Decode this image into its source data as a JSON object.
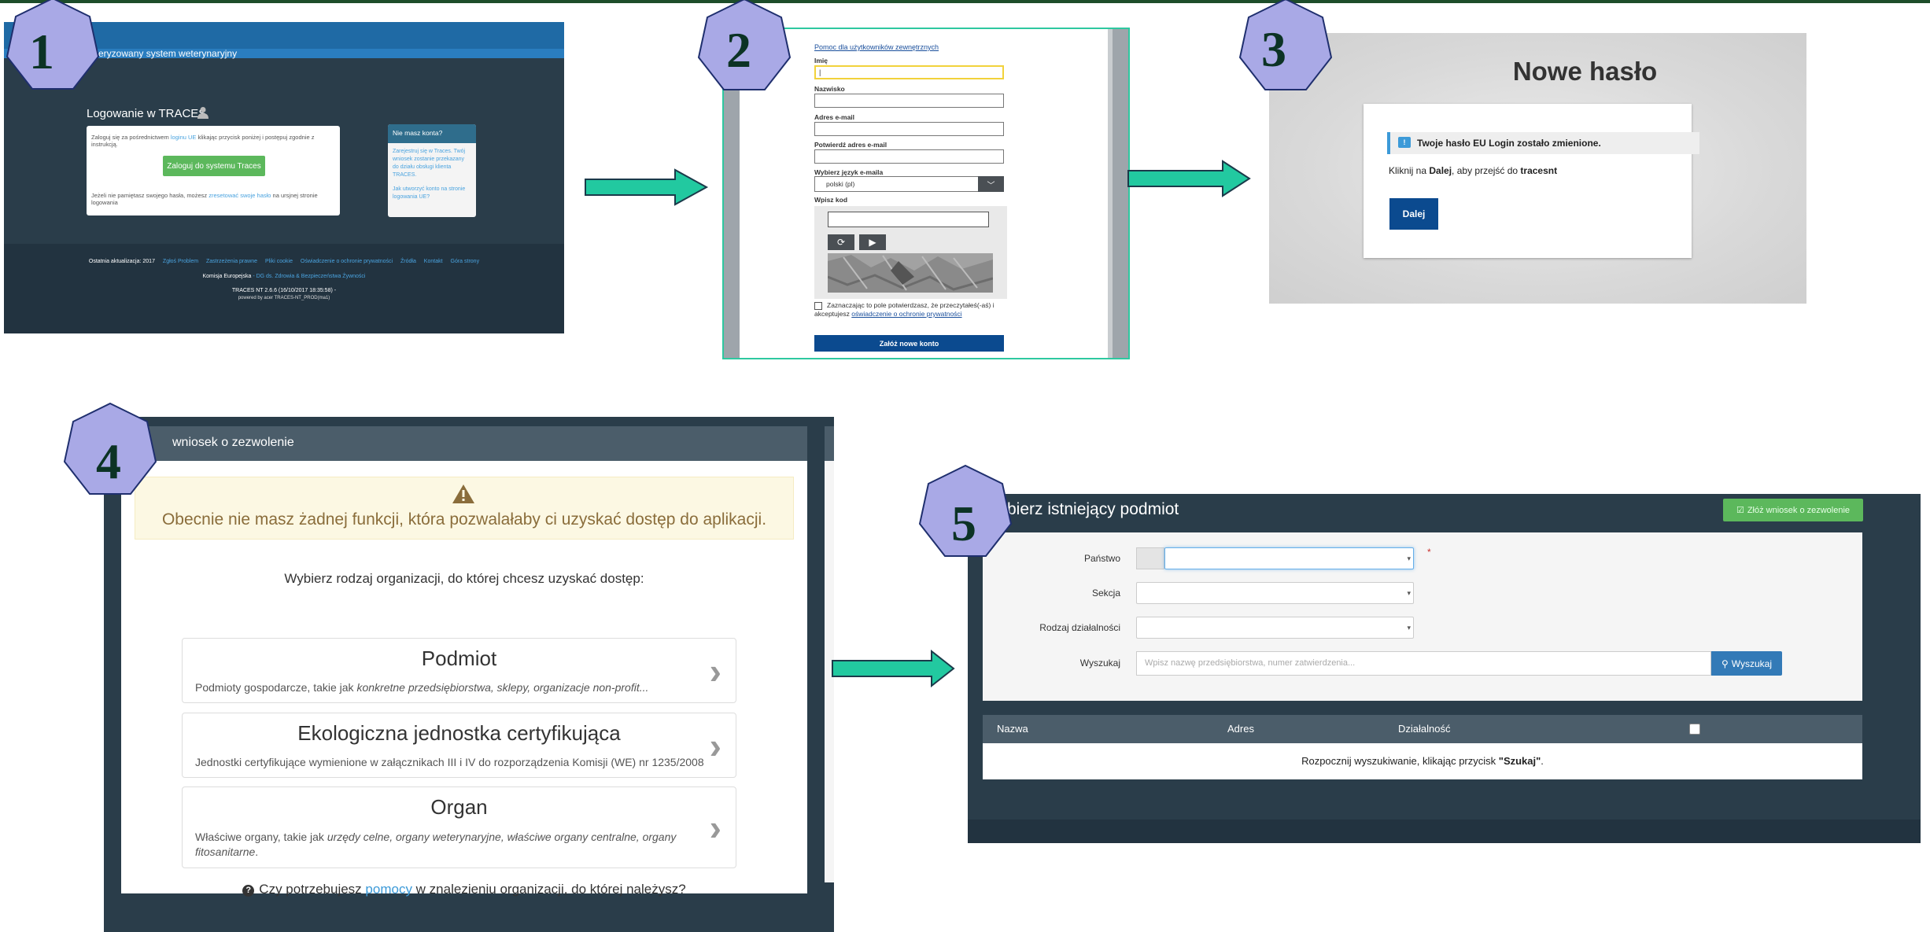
{
  "badges": [
    "1",
    "2",
    "3",
    "4",
    "5"
  ],
  "colors": {
    "badge_fill": "#a9a9e6",
    "badge_stroke": "#1f2f6e",
    "arrow_fill": "#22c9a0",
    "badge_text": "#0c3325"
  },
  "panel1": {
    "app_title": "uteryzowany system weterynaryjny",
    "login_title": "Logowanie w TRACES",
    "instr_pre": "Zaloguj się za pośrednictwem ",
    "instr_link": "loginu UE",
    "instr_post": " klikając przycisk poniżej i postępuj zgodnie z instrukcją.",
    "login_button": "Zaloguj do systemu Traces",
    "forgot_pre": "Jeżeli nie pamiętasz swojego hasła, możesz ",
    "forgot_link": "zresetować swoje hasło",
    "forgot_post": " na ursjnej stronie logowania",
    "side_title": "Nie masz konta?",
    "side_text1": "Zarejestruj się w Traces. Twój wniosek zostanie przekazany do działu obsługi klienta TRACES.",
    "side_text2": "Jak utworzyć konto na stronie logowania UE?",
    "footer_links": [
      "Ostatnia aktualizacja: 2017",
      "Zgłoś Problem",
      "Zastrzeżenia prawne",
      "Pliki cookie",
      "Oświadczenie o ochronie prywatności",
      "Źródła",
      "Kontakt",
      "Góra strony"
    ],
    "footer_line2_a": "Komisja Europejska",
    "footer_line2_b": " - DG ds. Zdrowia & Bezpieczeństwa Żywności",
    "footer_line3": "TRACES NT 2.6.6 (16/10/2017 18:35:58) -",
    "footer_line4": "powered by acer TRACES-NT_PROD(ma1)"
  },
  "panel2": {
    "help_link": "Pomoc dla użytkowników zewnętrznych",
    "first_name_label": "Imię",
    "first_name_value": "|",
    "last_name_label": "Nazwisko",
    "email_label": "Adres e-mail",
    "email_confirm_label": "Potwierdź adres e-mail",
    "lang_label": "Wybierz język e-maila",
    "lang_value": "polski (pl)",
    "captcha_label": "Wpisz kod",
    "consent_text": "Zaznaczając to pole potwierdzasz, że przeczytałeś(-aś) i akceptujesz ",
    "consent_link": "oświadczenie o ochronie prywatności",
    "create_button": "Załóż nowe konto"
  },
  "panel3": {
    "title": "Nowe hasło",
    "alert_text": "Twoje hasło EU Login zostało zmienione.",
    "line_pre": "Kliknij na ",
    "line_bold1": "Dalej",
    "line_mid": ", aby przejść do ",
    "line_bold2": "tracesnt",
    "next_button": "Dalej"
  },
  "panel4": {
    "header": "wniosek o zezwolenie",
    "warning": "Obecnie nie masz żadnej funkcji, która pozwalałaby ci uzyskać dostęp do aplikacji.",
    "choose": "Wybierz rodzaj organizacji, do której chcesz uzyskać dostęp:",
    "options": [
      {
        "title": "Podmiot",
        "desc_pre": "Podmioty gospodarcze, takie jak ",
        "desc_em": "konkretne przedsiębiorstwa, sklepy, organizacje non-profit...",
        "desc_post": ""
      },
      {
        "title": "Ekologiczna jednostka certyfikująca",
        "desc_pre": "Jednostki certyfikujące wymienione w załącznikach III i IV do rozporządzenia Komisji (WE) nr 1235/2008",
        "desc_em": "",
        "desc_post": ""
      },
      {
        "title": "Organ",
        "desc_pre": "Właściwe organy, takie jak ",
        "desc_em": "urzędy celne, organy weterynaryjne, właściwe organy centralne, organy fitosanitarne",
        "desc_post": "."
      }
    ],
    "help_pre": "Czy potrzebujesz ",
    "help_link": "pomocy",
    "help_post": " w znalezieniu organizacji, do której należysz?"
  },
  "panel5": {
    "title": "bierz istniejący podmiot",
    "apply_button": "Złóż wniosek o zezwolenie",
    "country_label": "Państwo",
    "section_label": "Sekcja",
    "activity_label": "Rodzaj działalności",
    "search_label": "Wyszukaj",
    "search_placeholder": "Wpisz nazwę przedsiębiorstwa, numer zatwierdzenia...",
    "search_button": "Wyszukaj",
    "col_name": "Nazwa",
    "col_address": "Adres",
    "col_activity": "Działalność",
    "empty_pre": "Rozpocznij wyszukiwanie, klikając przycisk ",
    "empty_bold": "\"Szukaj\"",
    "empty_post": "."
  }
}
